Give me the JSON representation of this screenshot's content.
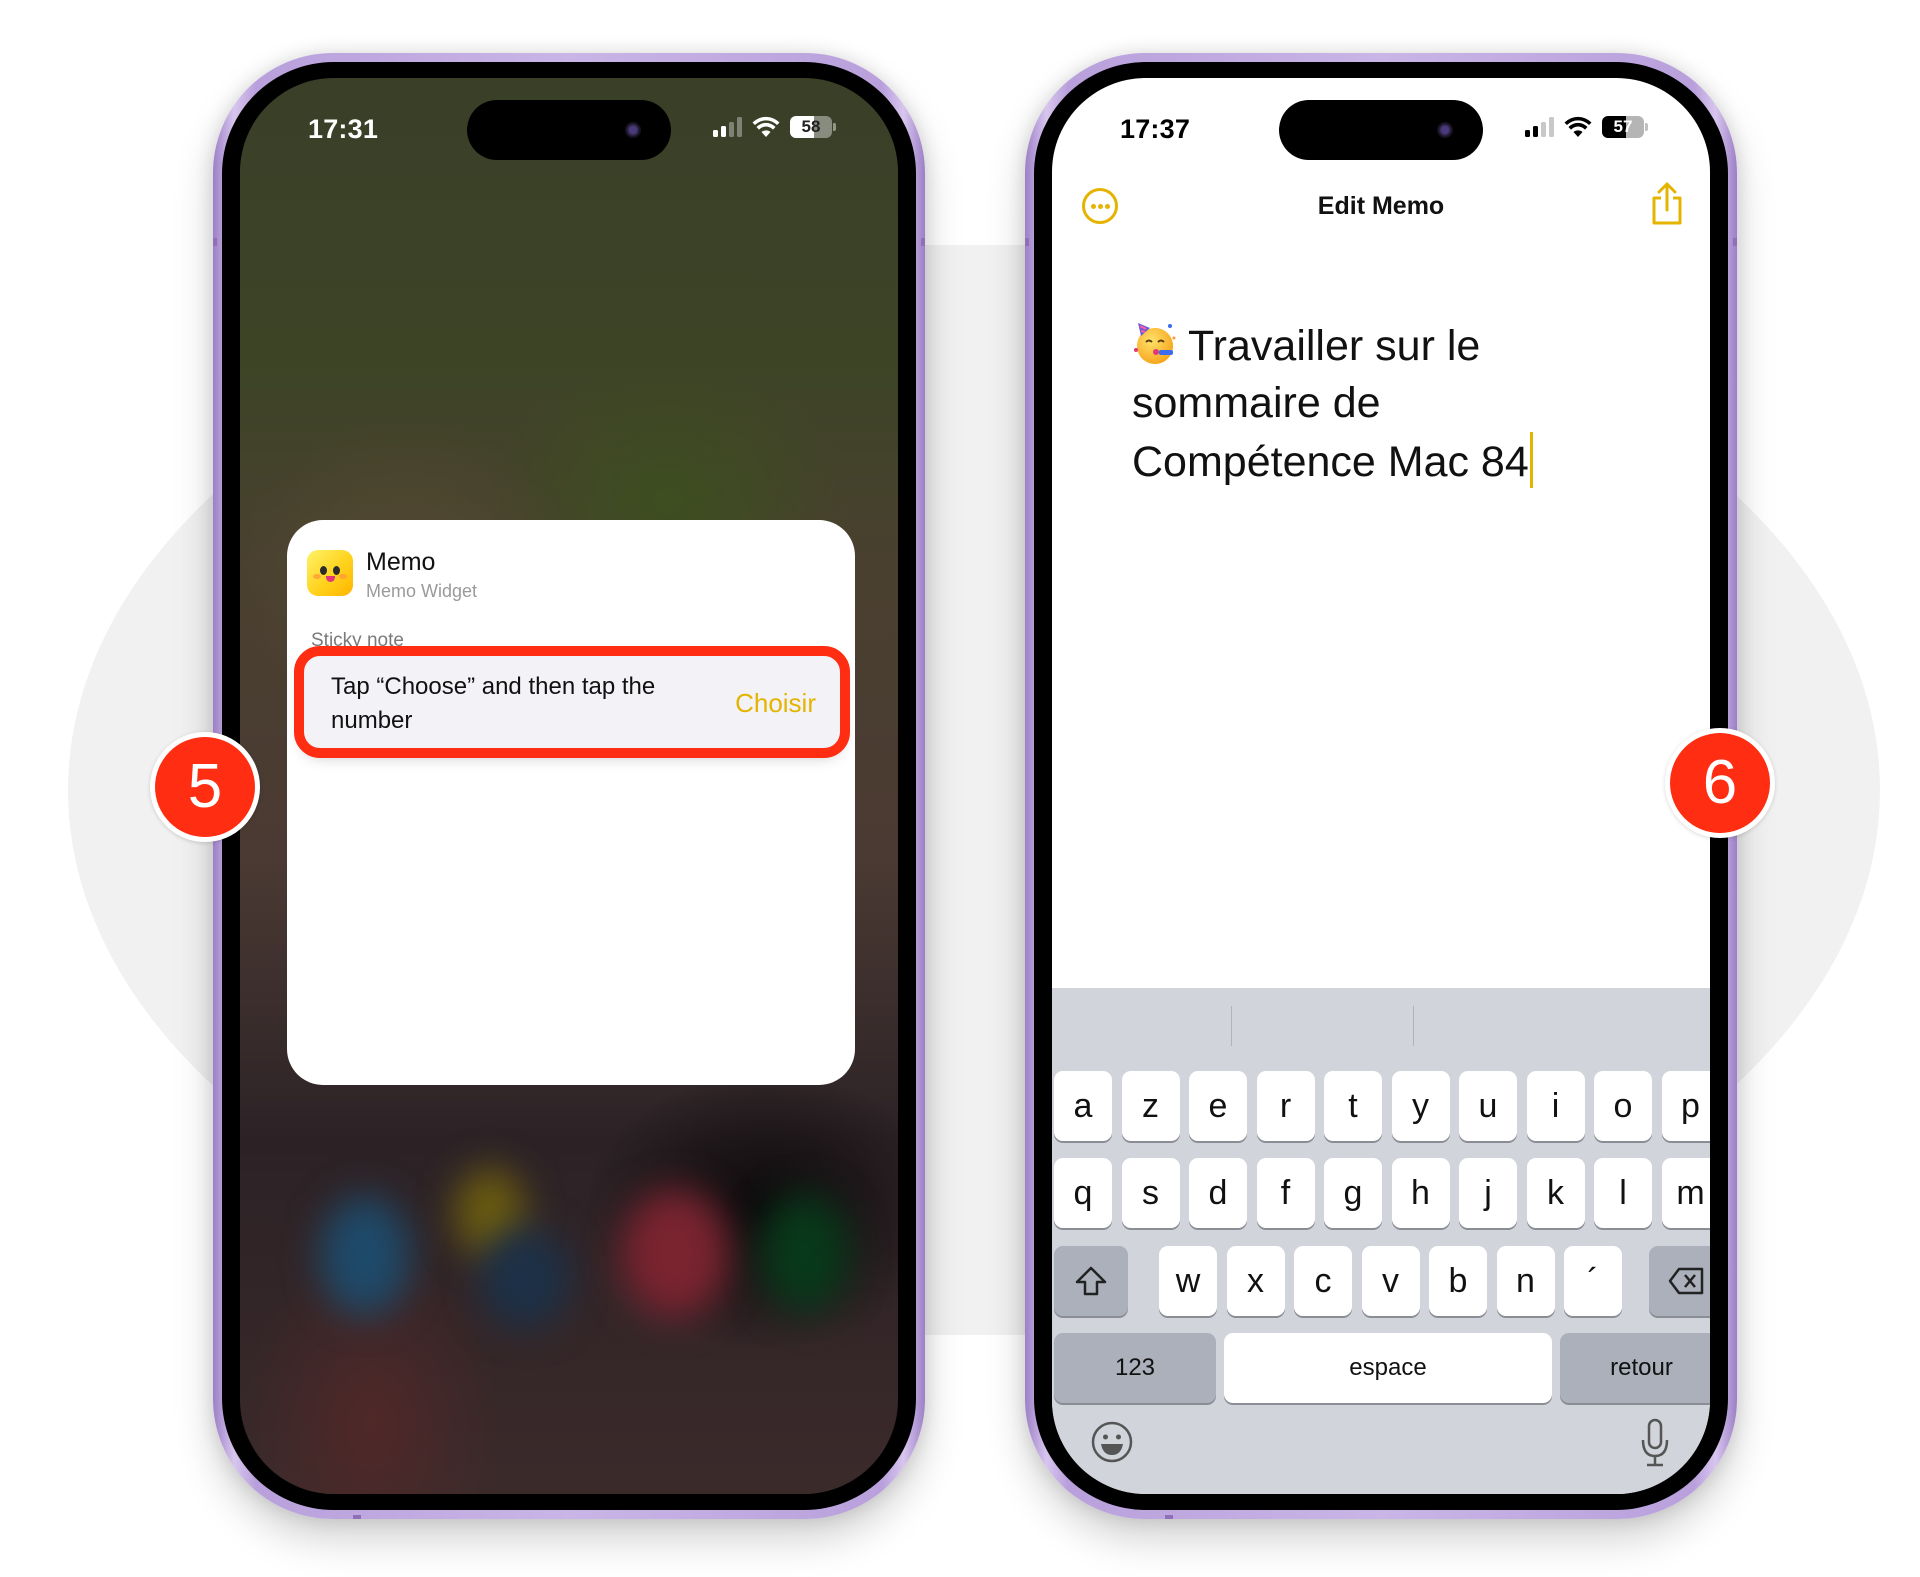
{
  "colors": {
    "accent_yellow": "#e5b400",
    "highlight_red": "#ff2d12",
    "frame_purple": "#c9b5e6",
    "keyboard_bg": "#d1d4db"
  },
  "steps": {
    "left_badge": "5",
    "right_badge": "6"
  },
  "left_phone": {
    "status": {
      "time": "17:31",
      "battery": "58",
      "battery_level": 0.58,
      "signal_bars": 2
    },
    "widget": {
      "app_name": "Memo",
      "app_subtitle": "Memo Widget",
      "section_label": "Sticky note",
      "note_text": "Tap “Choose” and then tap the number",
      "choose_button": "Choisir",
      "icon": "memo-smiley-app-icon"
    },
    "dock_icons": [
      "blurred-app-blue",
      "blurred-app-yellow-blue",
      "blurred-app-red",
      "blurred-app-green"
    ]
  },
  "right_phone": {
    "status": {
      "time": "17:37",
      "battery": "57",
      "battery_level": 0.57,
      "signal_bars": 2
    },
    "nav": {
      "title": "Edit Memo",
      "left_icon": "ellipsis-circle-icon",
      "right_icon": "share-icon"
    },
    "memo": {
      "emoji": "partying-face",
      "lines": [
        "Travailler sur le",
        "sommaire de",
        "Compétence Mac 84"
      ]
    },
    "keyboard": {
      "row1": [
        "a",
        "z",
        "e",
        "r",
        "t",
        "y",
        "u",
        "i",
        "o",
        "p"
      ],
      "row2": [
        "q",
        "s",
        "d",
        "f",
        "g",
        "h",
        "j",
        "k",
        "l",
        "m"
      ],
      "row3": [
        "w",
        "x",
        "c",
        "v",
        "b",
        "n",
        "´"
      ],
      "numbers_key": "123",
      "space_key": "espace",
      "return_key": "retour"
    }
  }
}
